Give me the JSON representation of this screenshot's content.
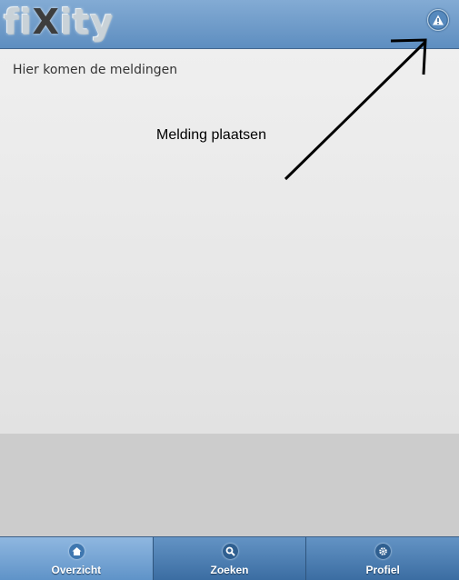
{
  "header": {
    "logo_part1": "fi",
    "logo_x": "X",
    "logo_part2": "ity",
    "alert_icon": "warning-icon"
  },
  "main": {
    "message": "Hier komen de meldingen"
  },
  "annotation": {
    "label": "Melding plaatsen"
  },
  "footer": {
    "tabs": [
      {
        "label": "Overzicht",
        "icon": "home-icon",
        "active": true
      },
      {
        "label": "Zoeken",
        "icon": "search-icon",
        "active": false
      },
      {
        "label": "Profiel",
        "icon": "gear-icon",
        "active": false
      }
    ]
  }
}
